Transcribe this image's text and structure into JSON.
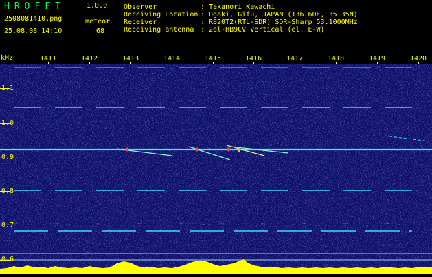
{
  "app": {
    "title": "HROFFT",
    "version": "1.0.0"
  },
  "file": {
    "name": "2508081410.png",
    "datetime": "25.08.08 14:10"
  },
  "counter": {
    "label": "meteor",
    "value": "68"
  },
  "info": [
    {
      "key": "Observer",
      "sep": ":",
      "value": "Takanori Kawachi"
    },
    {
      "key": "Receiving Location",
      "sep": ":",
      "value": "Ogaki, Gifu, JAPAN (136.60E, 35.35N)"
    },
    {
      "key": "Receiver",
      "sep": ":",
      "value": "R820T2(RTL-SDR) SDR-Sharp 53.1000MHz"
    },
    {
      "key": "Receiving antenna",
      "sep": ":",
      "value": "2el-HB9CV Vertical (el. E-W)"
    }
  ],
  "x_axis": {
    "ticks": [
      "1411",
      "1412",
      "1413",
      "1414",
      "1415",
      "1416",
      "1417",
      "1418",
      "1419",
      "1420"
    ]
  },
  "y_axis": {
    "unit": "kHz",
    "ticks": [
      "1.1",
      "1.0",
      "0.9",
      "0.8",
      "0.7",
      "0.6"
    ]
  },
  "colors": {
    "text": "#ffff00",
    "title": "#00ff40",
    "background": "#10106a",
    "trace": "#00e0ff",
    "baseline": "#00e0ff",
    "activity": "#ffff00"
  }
}
